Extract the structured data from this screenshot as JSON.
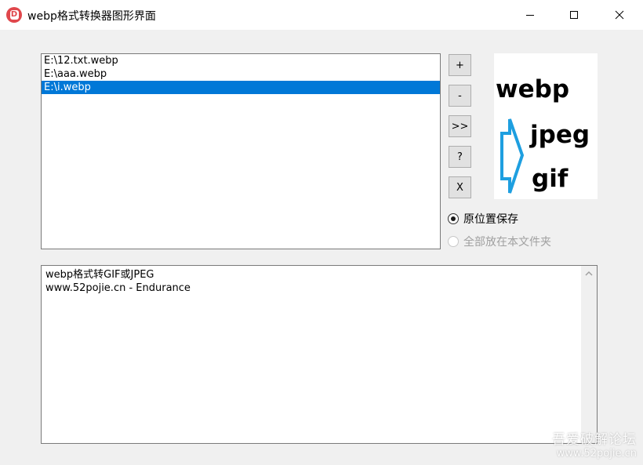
{
  "window": {
    "title": "webp格式转换器图形界面"
  },
  "file_list": {
    "items": [
      "E:\\12.txt.webp",
      "E:\\aaa.webp",
      "E:\\i.webp"
    ],
    "selected_index": 2
  },
  "buttons": {
    "add_label": "+",
    "remove_label": "-",
    "convert_label": ">>",
    "help_label": "?",
    "clear_label": "X"
  },
  "logo": {
    "line1": "webp",
    "line2": "jpeg",
    "line3": "gif",
    "arrow_color": "#1e9fe0"
  },
  "save_options": {
    "option1": "原位置保存",
    "option2": "全部放在本文件夹"
  },
  "output": {
    "lines": [
      "webp格式转GIF或JPEG",
      "www.52pojie.cn - Endurance"
    ]
  },
  "watermark": {
    "line1": "吾爱破解论坛",
    "line2": "www.52pojie.cn"
  },
  "colors": {
    "selection": "#0078d7",
    "app_icon": "#e0474c"
  }
}
